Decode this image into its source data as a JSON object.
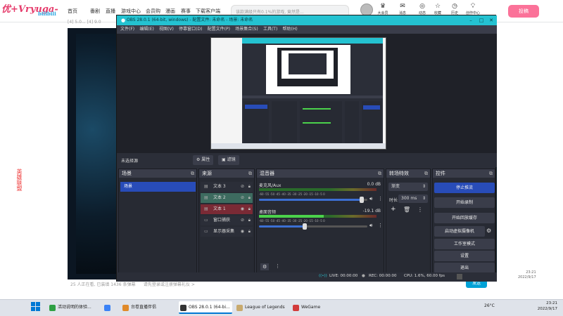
{
  "watermark": {
    "text": "优+Vryuga-",
    "sub": "bilibili"
  },
  "browser": {
    "nav": [
      "首页",
      "番剧",
      "直播",
      "游戏中心",
      "会员购",
      "漫画",
      "赛事",
      "下载客户端"
    ],
    "search_placeholder": "该款满级只有0.1%的游戏, 竟然是...",
    "right_items": [
      "大会员",
      "消息",
      "动态",
      "收藏",
      "历史",
      "创作中心"
    ],
    "upload": "投稿",
    "url_fragment": "[4] 5.0... [4] 9.0"
  },
  "page": {
    "left_text": "英雄联盟",
    "bottom_info": "25 人正在看, 已装填 1436 条弹幕",
    "bottom_hint": "请先登录或注册弹幕礼仪 >",
    "send": "发送",
    "right_labels": [
      "人"
    ],
    "date_lines": [
      "23:21",
      "2022/9/17"
    ]
  },
  "obs": {
    "title": "OBS 28.0.1 (64-bit, windows) - 配置文件: 未命名 - 场景: 未命名",
    "menu": [
      "文件(F)",
      "编辑(E)",
      "视图(V)",
      "停靠窗口(D)",
      "配置文件(P)",
      "场景集合(S)",
      "工具(T)",
      "帮助(H)"
    ],
    "source_bar": {
      "name": "未选择源",
      "properties": "属性",
      "filters": "滤镜"
    },
    "docks": {
      "scenes": {
        "title": "场景",
        "items": [
          "场景"
        ]
      },
      "sources": {
        "title": "来源",
        "items": [
          {
            "name": "文本 3",
            "visible": false
          },
          {
            "name": "文本 2",
            "visible": false
          },
          {
            "name": "文本 1",
            "visible": true
          },
          {
            "name": "窗口捕获",
            "visible": false
          },
          {
            "name": "显示器采集",
            "visible": true
          }
        ]
      },
      "mixer": {
        "title": "混音器",
        "channels": [
          {
            "name": "麦克风/Aux",
            "db": "0.0 dB",
            "volume": 0.95,
            "level": 0.0
          },
          {
            "name": "桌面音频",
            "db": "-19.1 dB",
            "volume": 0.42,
            "level": 0.55
          }
        ],
        "ticks": "-60 -55 -50 -45 -40 -35 -30 -25 -20 -15 -10 -5 0"
      },
      "transitions": {
        "title": "转场特效",
        "type": "渐变",
        "duration_label": "时长",
        "duration": "300 ms"
      },
      "controls": {
        "title": "控件",
        "buttons": [
          "停止推流",
          "开始录制",
          "开始回放缓存",
          "启动虚拟摄像机",
          "工作室模式",
          "设置",
          "退出"
        ]
      }
    },
    "status": {
      "live": "LIVE: 00:00:00",
      "rec": "REC: 00:00:00",
      "cpu": "CPU: 1.6%, 60.00 fps"
    }
  },
  "taskbar": {
    "apps": [
      {
        "label": "活动说明的体验...",
        "color": "#2ea043"
      },
      {
        "label": "",
        "color": "#3b82f6"
      },
      {
        "label": "台卷直播伴侣",
        "color": "#e08a2a"
      },
      {
        "label": "OBS 28.0.1 (64-bi...",
        "color": "#333333"
      },
      {
        "label": "League of Legends",
        "color": "#c8aa6e"
      },
      {
        "label": "WeGame",
        "color": "#d23b3b"
      }
    ],
    "weather": "26°C",
    "clock": [
      "23:21",
      "2022/9/17"
    ]
  }
}
